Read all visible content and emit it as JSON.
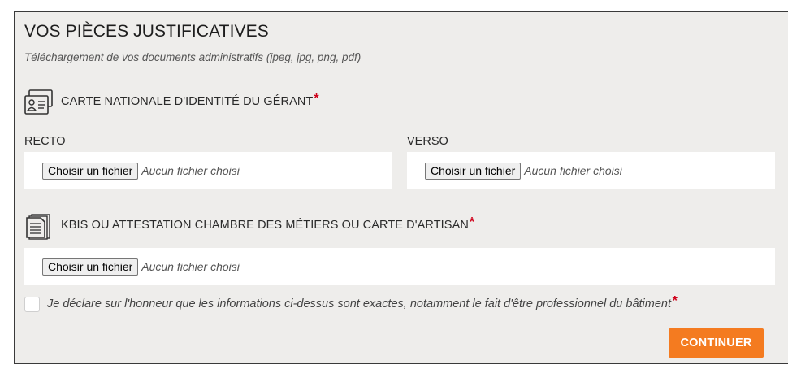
{
  "section": {
    "title": "VOS PIÈCES JUSTIFICATIVES",
    "subtitle": "Téléchargement de vos documents administratifs (jpeg, jpg, png, pdf)"
  },
  "id_card": {
    "icon": "id-card-icon",
    "label": "CARTE NATIONALE D'IDENTITÉ DU GÉRANT",
    "required_mark": "*",
    "recto": {
      "label": "RECTO",
      "button": "Choisir un fichier",
      "status": "Aucun fichier choisi"
    },
    "verso": {
      "label": "VERSO",
      "button": "Choisir un fichier",
      "status": "Aucun fichier choisi"
    }
  },
  "kbis": {
    "icon": "documents-icon",
    "label": "KBIS OU ATTESTATION CHAMBRE DES MÉTIERS OU CARTE D'ARTISAN",
    "required_mark": "*",
    "upload": {
      "button": "Choisir un fichier",
      "status": "Aucun fichier choisi"
    }
  },
  "declaration": {
    "text": "Je déclare sur l'honneur que les informations ci-dessus sont exactes, notamment le fait d'être professionnel du bâtiment",
    "required_mark": "*",
    "checked": false
  },
  "actions": {
    "continue_label": "CONTINUER"
  },
  "colors": {
    "accent": "#f47b20",
    "required": "#d0021b",
    "panel_bg": "#eeedeb"
  }
}
